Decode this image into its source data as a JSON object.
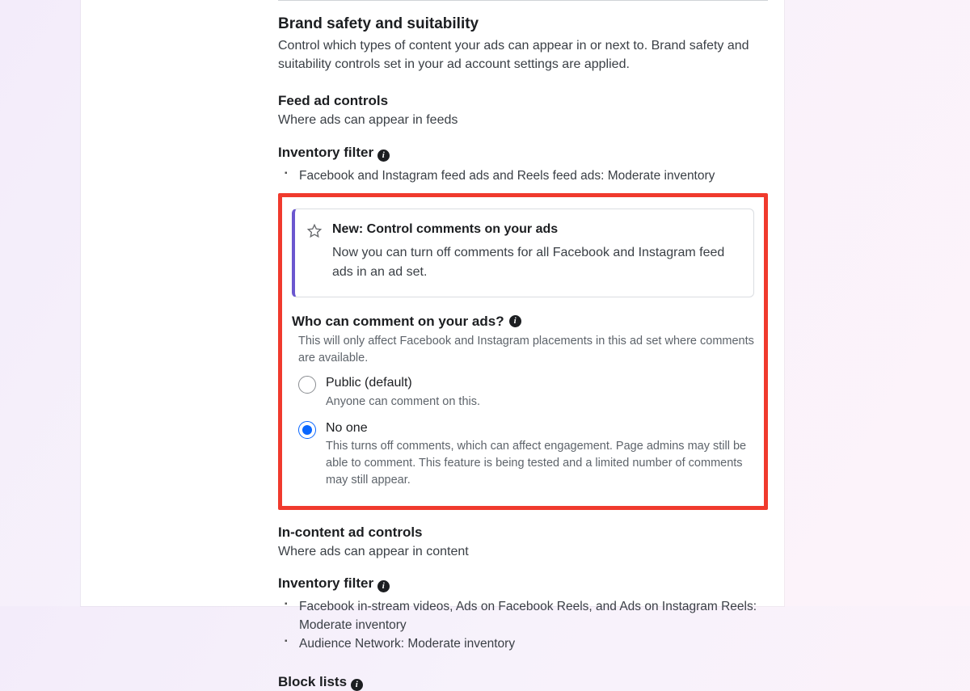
{
  "brandSafety": {
    "title": "Brand safety and suitability",
    "desc": "Control which types of content your ads can appear in or next to. Brand safety and suitability controls set in your ad account settings are applied."
  },
  "feedControls": {
    "title": "Feed ad controls",
    "desc": "Where ads can appear in feeds"
  },
  "inventoryFilter1": {
    "title": "Inventory filter",
    "items": [
      "Facebook and Instagram feed ads and Reels feed ads: Moderate inventory"
    ]
  },
  "callout": {
    "title": "New: Control comments on your ads",
    "body": "Now you can turn off comments for all Facebook and Instagram feed ads in an ad set."
  },
  "commentControl": {
    "title": "Who can comment on your ads?",
    "desc": "This will only affect Facebook and Instagram placements in this ad set where comments are available.",
    "options": [
      {
        "label": "Public (default)",
        "sub": "Anyone can comment on this.",
        "selected": false
      },
      {
        "label": "No one",
        "sub": "This turns off comments, which can affect engagement. Page admins may still be able to comment. This feature is being tested and a limited number of comments may still appear.",
        "selected": true
      }
    ]
  },
  "inContent": {
    "title": "In-content ad controls",
    "desc": "Where ads can appear in content"
  },
  "inventoryFilter2": {
    "title": "Inventory filter",
    "items": [
      "Facebook in-stream videos, Ads on Facebook Reels, and Ads on Instagram Reels: Moderate inventory",
      "Audience Network: Moderate inventory"
    ]
  },
  "blockLists": {
    "title": "Block lists"
  },
  "icons": {
    "info": "i",
    "star": "star-icon"
  }
}
